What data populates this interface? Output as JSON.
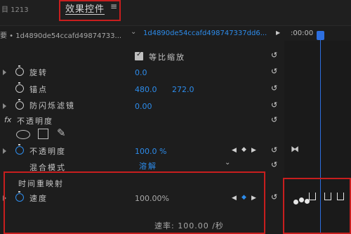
{
  "header": {
    "left_tab": "目 1213",
    "active_tab": "效果控件",
    "menu_icon": "hamburger-menu"
  },
  "sources": {
    "master_label": "要 • 1d4890de54ccafd49874733...",
    "clip_label": "1d4890de54ccafd498747337dd6...",
    "time_start": ":00:00"
  },
  "effects": {
    "uniform_scale": {
      "label": "等比缩放",
      "checked": true
    },
    "rotation": {
      "label": "旋转",
      "value": "0.0"
    },
    "anchor": {
      "label": "锚点",
      "x": "480.0",
      "y": "272.0"
    },
    "anti_flicker": {
      "label": "防闪烁滤镜",
      "value": "0.00"
    },
    "opacity_group": {
      "fx": "fx",
      "label": "不透明度"
    },
    "opacity": {
      "label": "不透明度",
      "value": "100.0 %"
    },
    "blend_mode": {
      "label": "混合模式",
      "value": "溶解"
    },
    "time_remap": {
      "label": "时间重映射"
    },
    "speed": {
      "label": "速度",
      "value": "100.00%"
    },
    "rate": {
      "label": "速率: 100.00 /秒"
    }
  },
  "colors": {
    "accent": "#2d8ceb",
    "highlight": "#c81e1e",
    "bg": "#1d1d1d"
  }
}
